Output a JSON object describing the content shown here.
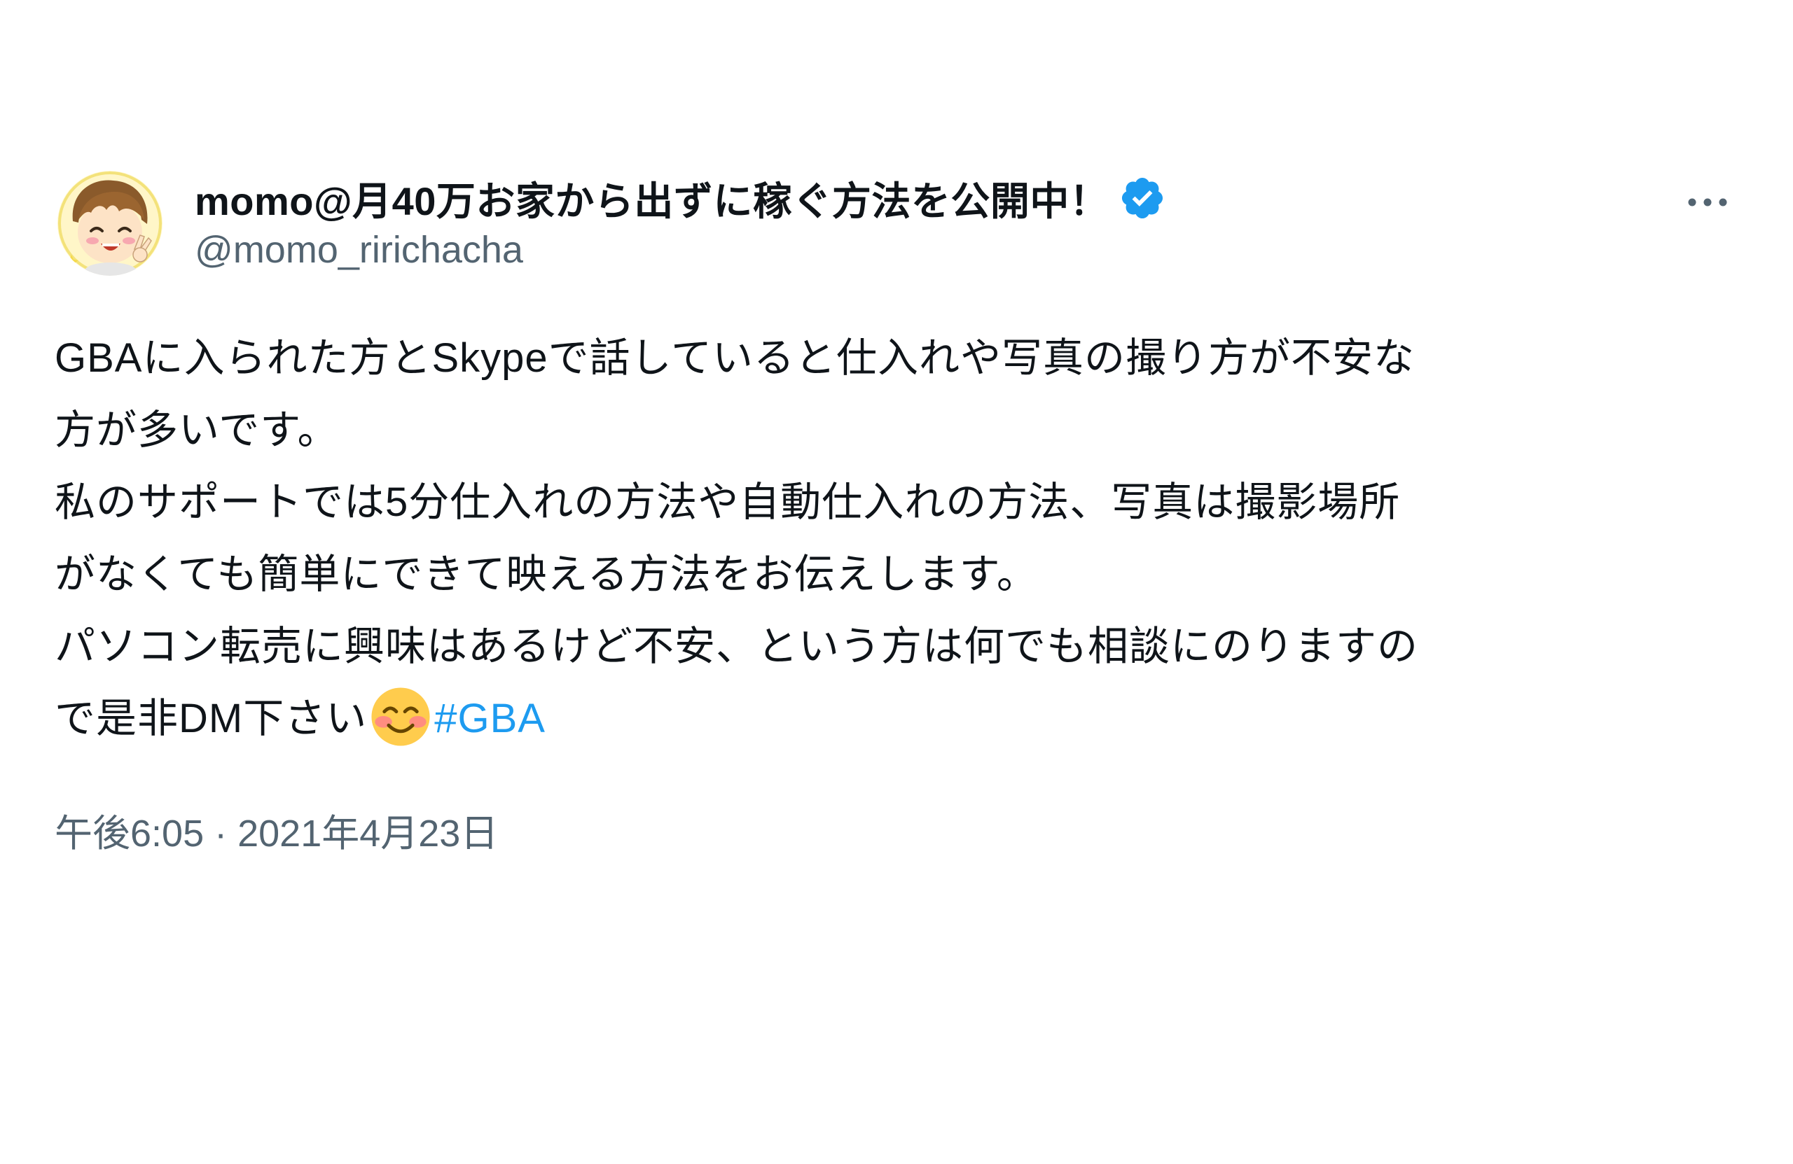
{
  "tweet": {
    "author": {
      "display_name": "momo@月40万お家から出ずに稼ぐ方法を公開中！",
      "handle": "@momo_ririchacha",
      "verified": true,
      "avatar_icon": "cartoon-avatar-icon"
    },
    "more_icon": "more-horizontal-icon",
    "text": {
      "line1": "GBAに入られた方とSkypeで話していると仕入れや写真の撮り方が不安な",
      "line2": "方が多いです。",
      "line3": "私のサポートでは5分仕入れの方法や自動仕入れの方法、写真は撮影場所",
      "line4": "がなくても簡単にできて映える方法をお伝えします。",
      "line5": "パソコン転売に興味はあるけど不安、という方は何でも相談にのりますの",
      "line6": "で是非DM下さい",
      "emoji": "smiling-face-icon",
      "hashtag": "#GBA"
    },
    "timestamp": {
      "time": "午後6:05",
      "separator": " · ",
      "date": "2021年4月23日"
    },
    "colors": {
      "text": "#0f1419",
      "secondary": "#536471",
      "accent": "#1d9bf0"
    }
  }
}
